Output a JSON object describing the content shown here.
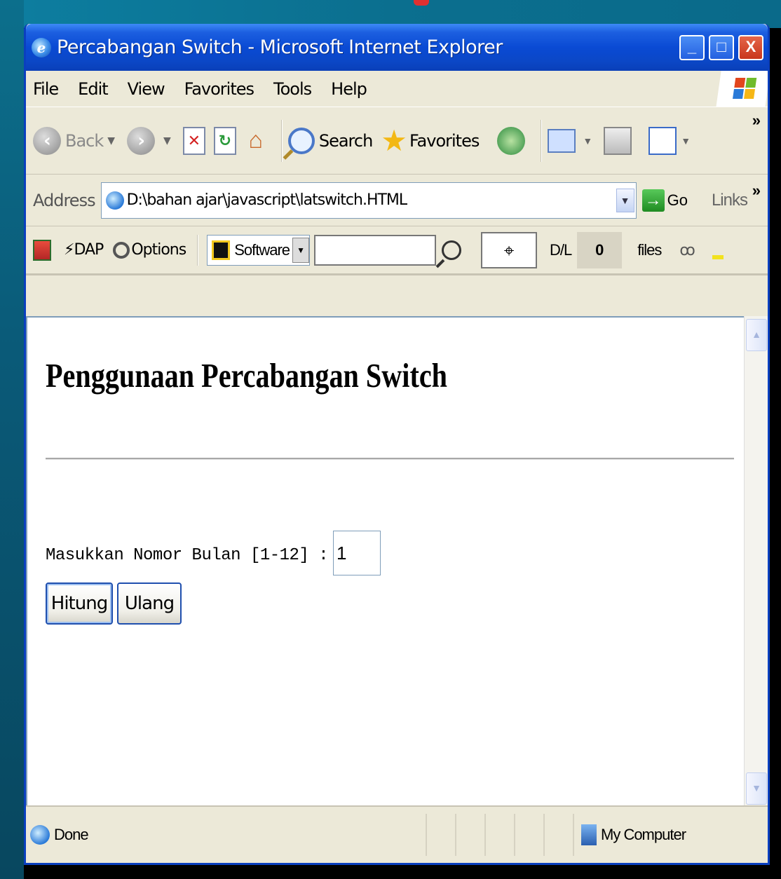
{
  "window": {
    "title": "Percabangan Switch - Microsoft Internet Explorer",
    "buttons": {
      "minimize": "_",
      "maximize": "□",
      "close": "X"
    }
  },
  "menu": [
    "File",
    "Edit",
    "View",
    "Favorites",
    "Tools",
    "Help"
  ],
  "toolbar": {
    "back_label": "Back",
    "search_label": "Search",
    "favorites_label": "Favorites",
    "overflow": "»"
  },
  "address": {
    "label": "Address",
    "value": "D:\\bahan ajar\\javascript\\latswitch.HTML",
    "go_label": "Go",
    "links_label": "Links",
    "overflow": "»"
  },
  "dapbar": {
    "dap_label": "DAP",
    "options_label": "Options",
    "software_label": "Software",
    "dl_label": "D/L",
    "dl_count": "0",
    "files_label": "files"
  },
  "page": {
    "heading": "Penggunaan Percabangan Switch",
    "form_label": "Masukkan Nomor Bulan [1-12] :",
    "input_value": "1",
    "button_hitung": "Hitung",
    "button_ulang": "Ulang"
  },
  "status": {
    "text": "Done",
    "zone": "My Computer"
  },
  "colors": {
    "titlebar": "#0a4ad4",
    "chrome": "#ece9d8",
    "border": "#0a3fbf"
  }
}
